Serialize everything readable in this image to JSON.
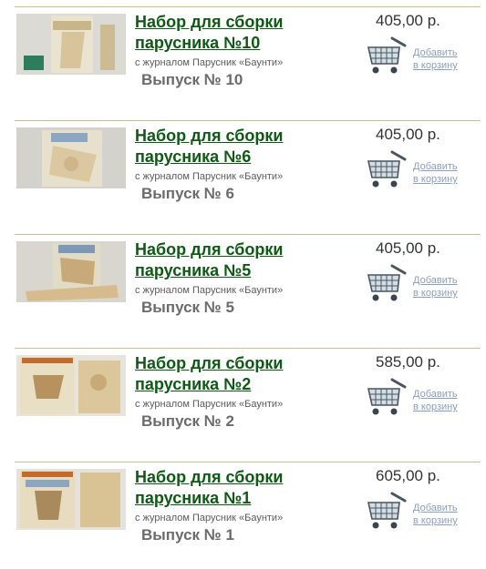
{
  "products": [
    {
      "title_line1": "Набор для сборки",
      "title_line2": "парусника №10",
      "subtitle": "с журналом Парусник «Баунти»",
      "issue": "Выпуск № 10",
      "price": "405,00 р.",
      "add_line1": "Добавить",
      "add_line2": "в корзину"
    },
    {
      "title_line1": "Набор для сборки",
      "title_line2": "парусника №6",
      "subtitle": "с журналом Парусник «Баунти»",
      "issue": "Выпуск № 6",
      "price": "405,00 р.",
      "add_line1": "Добавить",
      "add_line2": "в корзину"
    },
    {
      "title_line1": "Набор для сборки",
      "title_line2": "парусника №5",
      "subtitle": "с журналом Парусник «Баунти»",
      "issue": "Выпуск № 5",
      "price": "405,00 р.",
      "add_line1": "Добавить",
      "add_line2": "в корзину"
    },
    {
      "title_line1": "Набор для сборки",
      "title_line2": "парусника №2",
      "subtitle": "с журналом Парусник «Баунти»",
      "issue": "Выпуск № 2",
      "price": "585,00 р.",
      "add_line1": "Добавить",
      "add_line2": "в корзину"
    },
    {
      "title_line1": "Набор для сборки",
      "title_line2": "парусника №1",
      "subtitle": "с журналом Парусник «Баунти»",
      "issue": "Выпуск № 1",
      "price": "605,00 р.",
      "add_line1": "Добавить",
      "add_line2": "в корзину"
    }
  ],
  "icons": {
    "product_image": "product-photo",
    "cart": "shopping-cart-icon"
  },
  "colors": {
    "title": "#0e5a14",
    "link": "#8a9fc2",
    "divider": "#c9bf95",
    "price": "#333333"
  }
}
